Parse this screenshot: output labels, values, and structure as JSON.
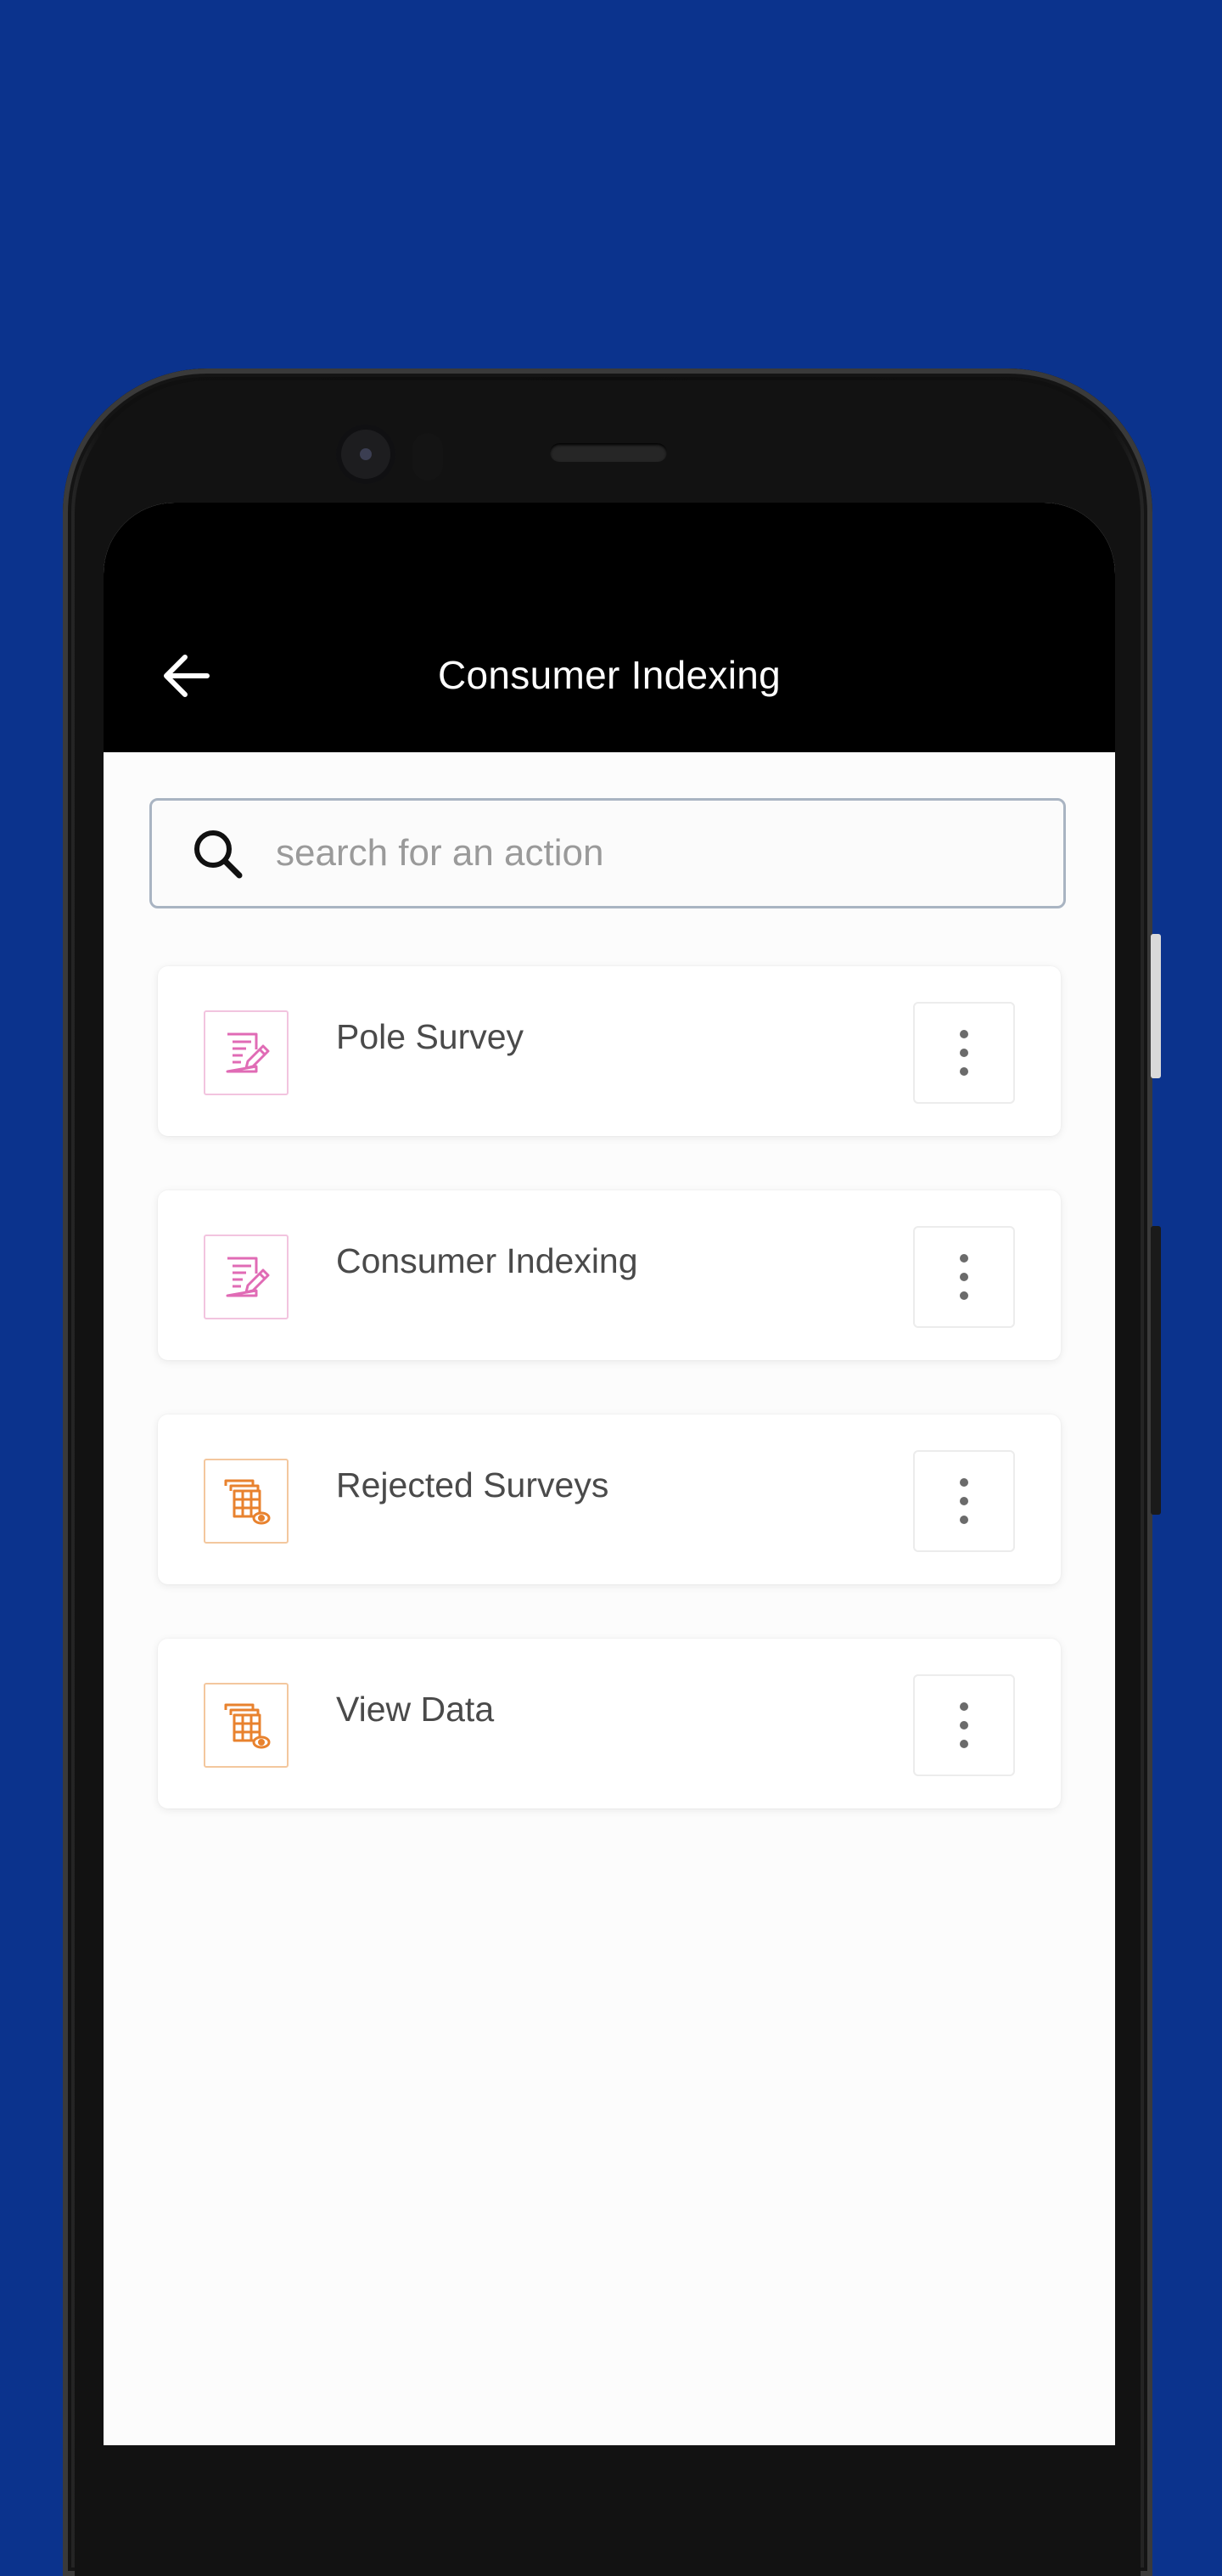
{
  "appbar": {
    "title": "Consumer Indexing",
    "back_icon": "arrow-left-icon"
  },
  "search": {
    "placeholder": "search for an action",
    "value": "",
    "icon": "search-icon"
  },
  "actions": [
    {
      "label": "Pole Survey",
      "icon": "form-edit-icon",
      "icon_color": "#e06bb5"
    },
    {
      "label": "Consumer Indexing",
      "icon": "form-edit-icon",
      "icon_color": "#e06bb5"
    },
    {
      "label": "Rejected Surveys",
      "icon": "table-view-icon",
      "icon_color": "#e8822e"
    },
    {
      "label": "View Data",
      "icon": "table-view-icon",
      "icon_color": "#e8822e"
    }
  ],
  "colors": {
    "background": "#0b338d",
    "appbar": "#000000",
    "screen": "#fcfcfc"
  }
}
